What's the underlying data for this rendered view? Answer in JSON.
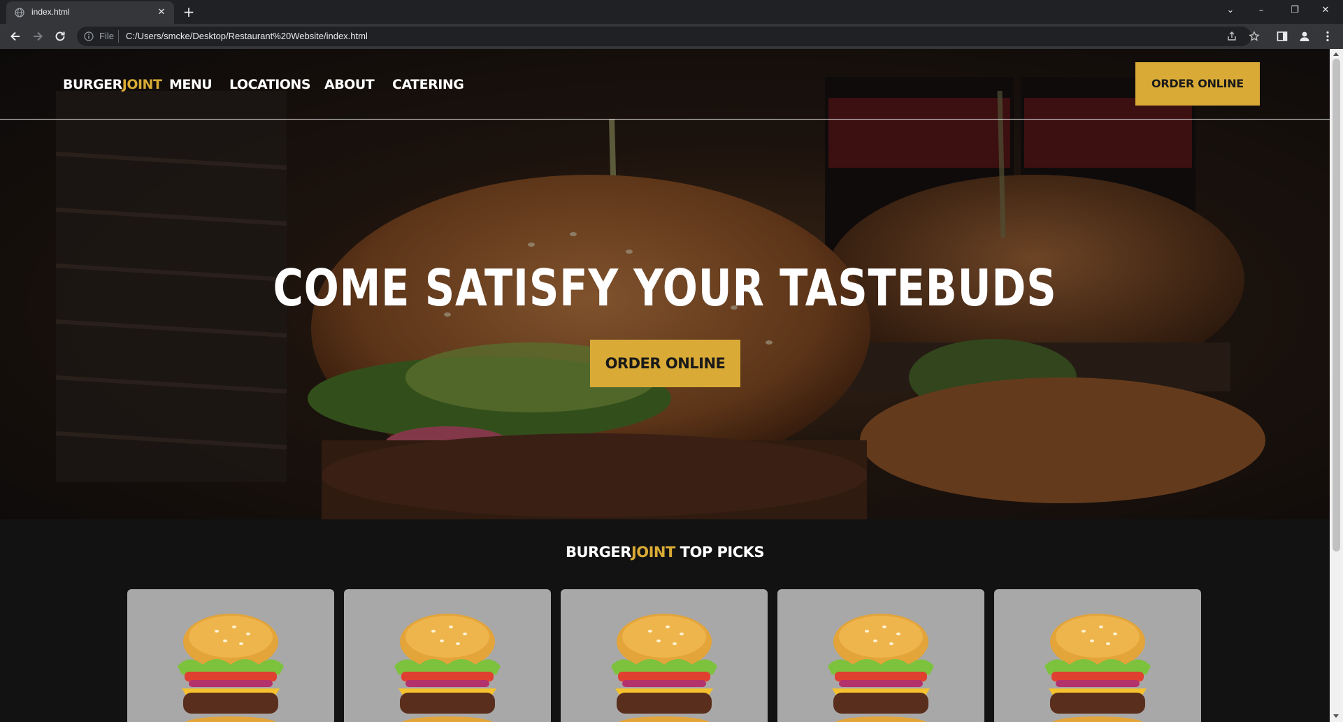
{
  "browser": {
    "tab_title": "index.html",
    "url_scheme": "File",
    "url": "C:/Users/smcke/Desktop/Restaurant%20Website/index.html"
  },
  "site": {
    "brand_primary": "BURGER",
    "brand_accent": "JOINT",
    "nav_links": [
      "MENU",
      "LOCATIONS",
      "ABOUT",
      "CATERING"
    ],
    "nav_order_label": "ORDER ONLINE"
  },
  "hero": {
    "heading": "COME SATISFY YOUR TASTEBUDS",
    "button_label": "ORDER ONLINE"
  },
  "top_picks": {
    "title_primary": "BURGER",
    "title_accent": "JOINT",
    "title_suffix": " TOP PICKS",
    "cards": [
      {
        "image": "burger-image"
      },
      {
        "image": "burger-image"
      },
      {
        "image": "burger-image"
      },
      {
        "image": "burger-image"
      },
      {
        "image": "burger-image"
      }
    ]
  },
  "colors": {
    "accent": "#d9ab36",
    "page_background": "#121212",
    "card_background": "#a8a8a8",
    "browser_frame": "#202124",
    "browser_toolbar": "#35363a"
  }
}
